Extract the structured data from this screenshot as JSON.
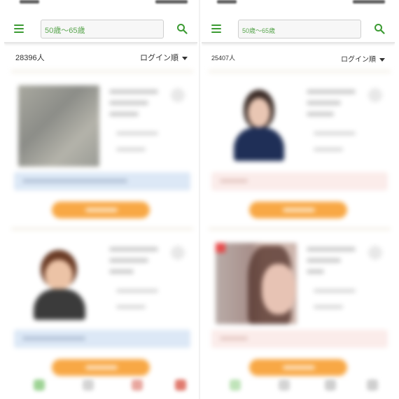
{
  "panels": [
    {
      "search": {
        "value": "50歳〜65歳"
      },
      "results": {
        "count": "28396人",
        "sort_label": "ログイン順"
      }
    },
    {
      "search": {
        "value": "50歳〜65歳"
      },
      "results": {
        "count": "25407人",
        "sort_label": "ログイン順"
      }
    }
  ],
  "colors": {
    "accent_green": "#3c9b33",
    "action_orange": "#f8a845",
    "message_blue": "#dce8f6",
    "message_pink": "#fbecea"
  }
}
